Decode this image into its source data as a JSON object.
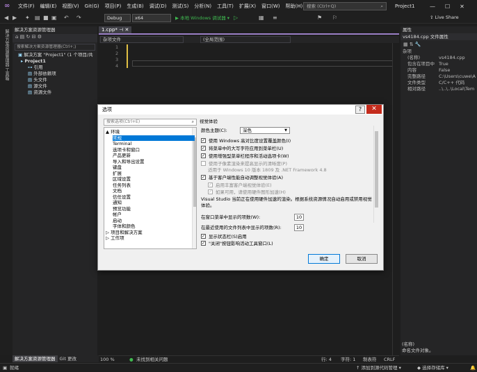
{
  "menus": [
    "文件(F)",
    "编辑(E)",
    "视图(V)",
    "Git(G)",
    "项目(P)",
    "生成(B)",
    "调试(D)",
    "测试(S)",
    "分析(N)",
    "工具(T)",
    "扩展(X)",
    "窗口(W)",
    "帮助(H)"
  ],
  "search": {
    "placeholder": "搜索 (Ctrl+Q)"
  },
  "project_name": "Project1",
  "toolbar": {
    "config": "Debug",
    "platform": "x64",
    "run_label": "▶ 本地 Windows 调试器 ▾",
    "live_share": "Live Share"
  },
  "left_strip": [
    "解决方案资源管理器",
    "工具箱"
  ],
  "solution_panel": {
    "title": "解决方案资源管理器",
    "search": "搜索解决方案资源管理器(Ctrl+;)",
    "items": [
      "解决方案 \"Project1\" (1 个项目/共",
      "Project1",
      "引用",
      "外部依赖项",
      "头文件",
      "源文件",
      "资源文件"
    ]
  },
  "editor": {
    "tab": "1.cpp*",
    "nav_left": "(全局范围)",
    "nav_project": "杂项文件",
    "line_numbers": [
      "1",
      "2",
      "3",
      "4"
    ]
  },
  "properties": {
    "title": "属性",
    "file": "vs4184.cpp 文件属性",
    "section": "杂项",
    "rows": [
      {
        "k": "(名称)",
        "v": "vs4184.cpp"
      },
      {
        "k": "包含在项目中",
        "v": "True"
      },
      {
        "k": "内容",
        "v": "False"
      },
      {
        "k": "完整路径",
        "v": "C:\\Users\\cuwe\\A"
      },
      {
        "k": "文件类型",
        "v": "C/C++ 代码"
      },
      {
        "k": "相对路径",
        "v": "..\\..\\..\\Local\\Tem"
      }
    ],
    "desc_title": "(名称)",
    "desc": "命名文件对象。"
  },
  "bottom_tabs": [
    "解决方案资源管理器",
    "Git 更改"
  ],
  "editor_status": {
    "zoom": "100 %",
    "issues": "未找到相关问题",
    "row": "行: 4",
    "col": "字符: 1",
    "mode": "制表符",
    "eol": "CRLF"
  },
  "statusbar": {
    "left": "就绪",
    "add_source": "↑ 添加到源代码管理 ▾",
    "select_repo": "◆ 选择存储库 ▾"
  },
  "dialog": {
    "title": "选项",
    "help": "?",
    "close": "✕",
    "search_placeholder": "搜索选项(Ctrl+E)",
    "tree": [
      {
        "t": "▲ 环境",
        "lvl": 0
      },
      {
        "t": "常规",
        "lvl": 1,
        "sel": true
      },
      {
        "t": "Terminal",
        "lvl": 1
      },
      {
        "t": "选项卡和窗口",
        "lvl": 1
      },
      {
        "t": "产品更新",
        "lvl": 1
      },
      {
        "t": "导入和导出设置",
        "lvl": 1
      },
      {
        "t": "键盘",
        "lvl": 1
      },
      {
        "t": "扩展",
        "lvl": 1
      },
      {
        "t": "区域设置",
        "lvl": 1
      },
      {
        "t": "任务列表",
        "lvl": 1
      },
      {
        "t": "文档",
        "lvl": 1
      },
      {
        "t": "信任设置",
        "lvl": 1
      },
      {
        "t": "通知",
        "lvl": 1
      },
      {
        "t": "预览功能",
        "lvl": 1
      },
      {
        "t": "帐户",
        "lvl": 1
      },
      {
        "t": "启动",
        "lvl": 1
      },
      {
        "t": "字体和颜色",
        "lvl": 1
      },
      {
        "t": "▷ 项目和解决方案",
        "lvl": 0
      },
      {
        "t": "▷ 工作项",
        "lvl": 0
      }
    ],
    "section_title": "视觉体验",
    "theme_label": "颜色主题(C):",
    "theme_value": "深色",
    "checks": [
      {
        "t": "使用 Windows 高对比度设置覆盖颜色(I)",
        "c": true,
        "dis": false
      },
      {
        "t": "将菜单中的大写字符应用到菜单栏(U)",
        "c": true,
        "dis": false
      },
      {
        "t": "使用增强型菜单栏程序和活动选项卡(W)",
        "c": true,
        "dis": false
      },
      {
        "t": "使用子像素渲染来提高显示的清晰度(P)",
        "c": false,
        "dis": true
      },
      {
        "t": "适用于 Windows 10 版本 1809 及 .NET Framework 4.8",
        "c": false,
        "dis": true
      },
      {
        "t": "基于客户端性能自动调整视觉体验(A)",
        "c": true,
        "dis": false
      },
      {
        "t": "启用丰富客户端视觉体验(E)",
        "c": true,
        "dis": true
      },
      {
        "t": "如果可用，请使用硬件图形加速(H)",
        "c": true,
        "dis": true
      }
    ],
    "note": "Visual Studio 当前正在使用硬件加速的渲染。根据系统资源情况自动启用或禁用视觉体验。",
    "window_menu_label": "在窗口菜单中显示的项数(W):",
    "window_menu_value": "10",
    "recent_label": "在最近使用的文件列表中显示的项数(R):",
    "recent_value": "10",
    "bottom_checks": [
      {
        "t": "显示状态栏(S)启用",
        "c": true
      },
      {
        "t": "\"关闭\"按钮影响活动工具窗口(L)",
        "c": true
      }
    ],
    "ok": "确定",
    "cancel": "取消"
  }
}
